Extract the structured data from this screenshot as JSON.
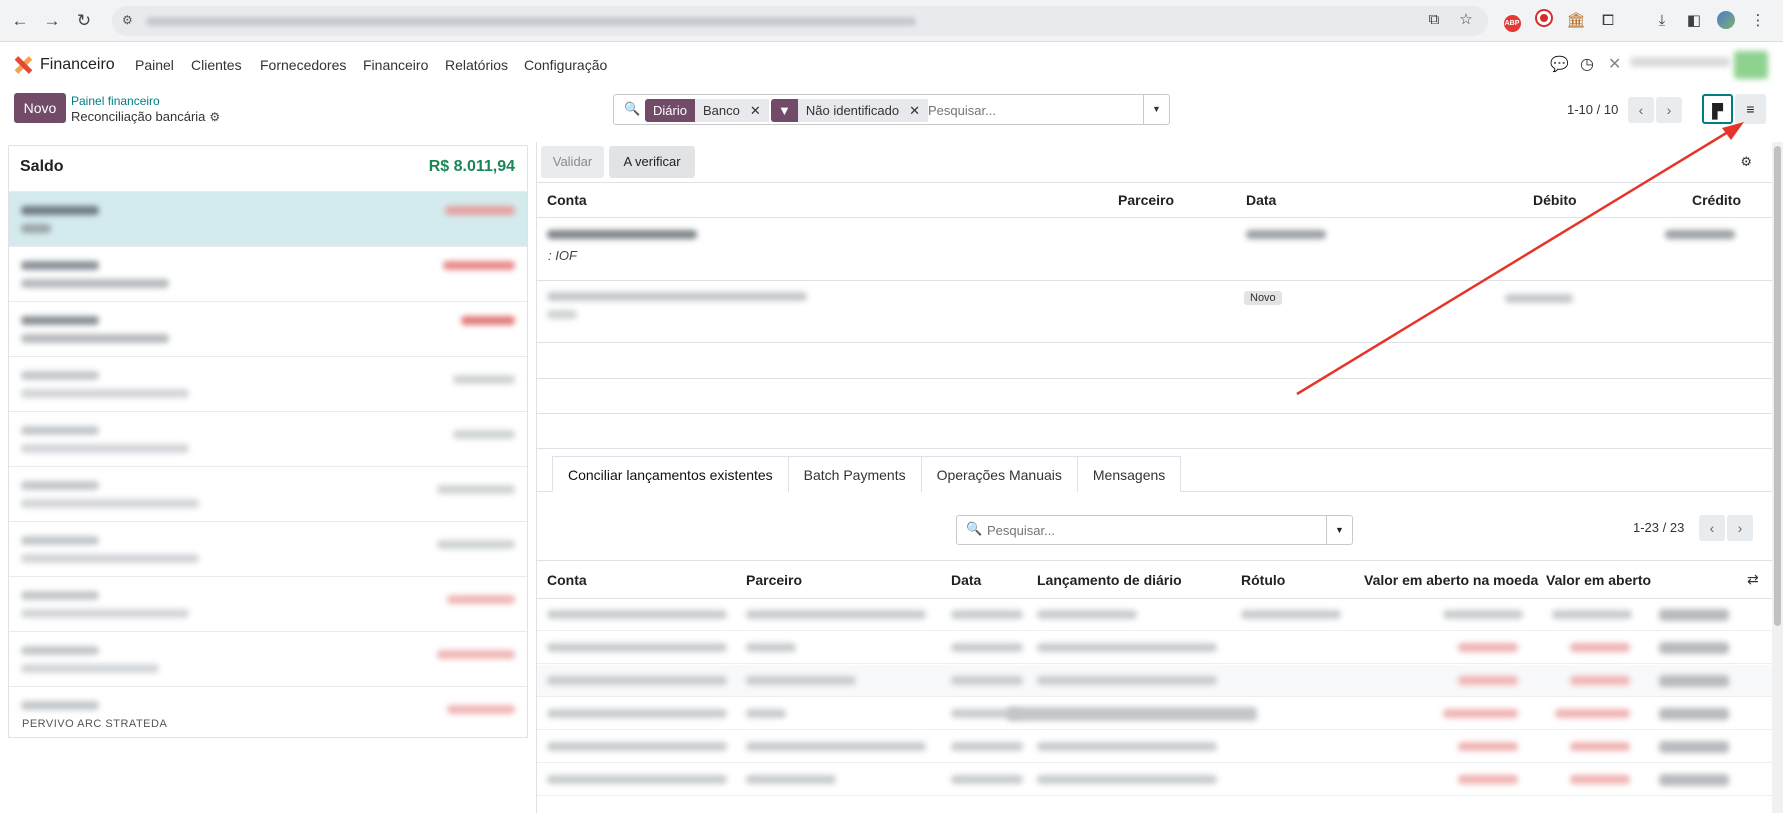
{
  "browser": {
    "nav_icons": [
      "back-arrow-icon",
      "forward-arrow-icon",
      "reload-icon",
      "site-info-icon"
    ],
    "toolbar_icons": [
      "install-app-icon",
      "bookmark-star-icon",
      "adblock-extension-icon",
      "record-extension-icon",
      "bank-extension-icon",
      "extensions-puzzle-icon",
      "download-icon",
      "side-panel-icon",
      "profile-avatar-icon",
      "menu-kebab-icon"
    ]
  },
  "app": {
    "brand": "Financeiro",
    "menu": [
      "Painel",
      "Clientes",
      "Fornecedores",
      "Financeiro",
      "Relatórios",
      "Configuração"
    ],
    "systray_icons": [
      "chat-icon",
      "clock-icon",
      "tools-icon"
    ]
  },
  "control": {
    "new_button": "Novo",
    "breadcrumb_parent": "Painel financeiro",
    "breadcrumb_current": "Reconciliação bancária",
    "search": {
      "facets": [
        {
          "tag": "Diário",
          "value": "Banco"
        },
        {
          "tag": "",
          "value": "Não identificado"
        }
      ],
      "placeholder": "Pesquisar..."
    },
    "pager": "1-10 / 10"
  },
  "left": {
    "saldo_label": "Saldo",
    "saldo_value": "R$ 8.011,94",
    "bottom_text": "PERVIVO ARC STRATEDA"
  },
  "right": {
    "toolbar": {
      "validate": "Validar",
      "to_check": "A verificar"
    },
    "columns": {
      "account": "Conta",
      "partner": "Parceiro",
      "date": "Data",
      "debit": "Débito",
      "credit": "Crédito"
    },
    "row1_label": ": IOF",
    "row2_badge": "Novo",
    "tabs": [
      "Conciliar lançamentos existentes",
      "Batch Payments",
      "Operações Manuais",
      "Mensagens"
    ],
    "inner_search_placeholder": "Pesquisar...",
    "inner_pager": "1-23 / 23",
    "sub_columns": [
      "Conta",
      "Parceiro",
      "Data",
      "Lançamento de diário",
      "Rótulo",
      "Valor em aberto na moeda",
      "Valor em aberto"
    ]
  },
  "colors": {
    "brand": "#714b67",
    "teal": "#017e84",
    "positive": "#198754",
    "annotation": "#e5352b"
  }
}
